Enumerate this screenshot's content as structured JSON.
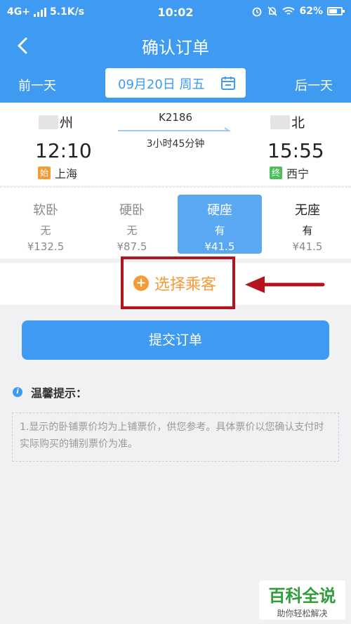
{
  "status_bar": {
    "network": "4G+",
    "speed": "5.1K/s",
    "time": "10:02",
    "battery": "62%"
  },
  "header": {
    "title": "确认订单",
    "back_icon": "chevron-left-icon"
  },
  "date_bar": {
    "prev_day": "前一天",
    "date": "09月20日 周五",
    "next_day": "后一天",
    "calendar_icon": "calendar-icon"
  },
  "train": {
    "number": "K2186",
    "duration": "3小时45分钟",
    "departure": {
      "city_visible": "州",
      "time": "12:10",
      "tag": "始",
      "station": "上海"
    },
    "arrival": {
      "city_visible": "北",
      "time": "15:55",
      "tag": "终",
      "station": "西宁"
    }
  },
  "seats": [
    {
      "name": "软卧",
      "availability": "无",
      "price": "¥132.5"
    },
    {
      "name": "硬卧",
      "availability": "无",
      "price": "¥87.5"
    },
    {
      "name": "硬座",
      "availability": "有",
      "price": "¥41.5"
    },
    {
      "name": "无座",
      "availability": "有",
      "price": "¥41.5"
    }
  ],
  "passenger": {
    "choose_label": "选择乘客"
  },
  "submit_label": "提交订单",
  "tips": {
    "title": "温馨提示：",
    "text": "1.显示的卧铺票价均为上铺票价，供您参考。具体票价以您确认支付时实际购买的铺别票价为准。"
  },
  "watermark": {
    "main": "百科全说",
    "sub": "助你轻松解决"
  },
  "colors": {
    "primary": "#3f9af1",
    "accent_orange": "#f59a35",
    "highlight_red": "#b5141f"
  }
}
